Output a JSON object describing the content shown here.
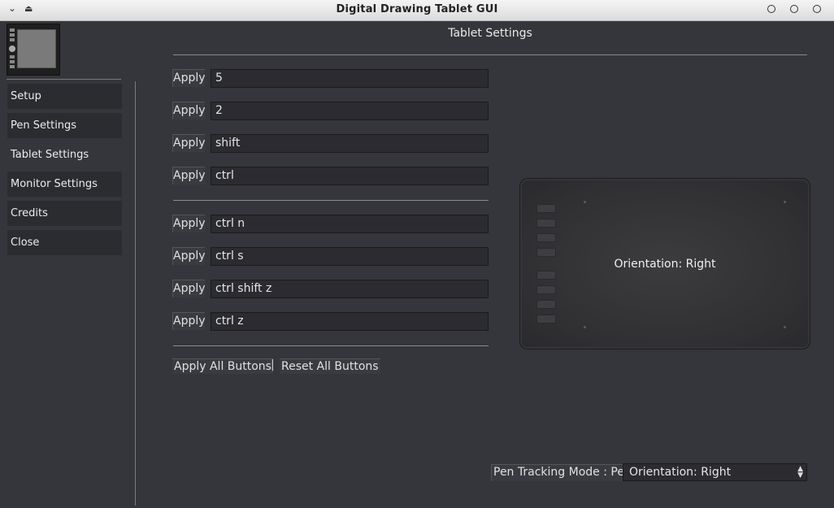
{
  "window": {
    "title": "Digital Drawing Tablet GUI"
  },
  "sidebar": {
    "items": [
      {
        "label": "Setup"
      },
      {
        "label": "Pen Settings"
      },
      {
        "label": "Tablet Settings"
      },
      {
        "label": "Monitor Settings"
      },
      {
        "label": "Credits"
      },
      {
        "label": "Close"
      }
    ],
    "active_index": 2
  },
  "main": {
    "title": "Tablet Settings",
    "apply_label": "Apply",
    "buttons_group_1": [
      "5",
      "2",
      "shift",
      "ctrl"
    ],
    "buttons_group_2": [
      "ctrl n",
      "ctrl s",
      "ctrl shift z",
      "ctrl z"
    ],
    "apply_all_label": "Apply All Buttons",
    "separator": "|",
    "reset_all_label": "Reset All Buttons"
  },
  "tablet": {
    "orientation_label": "Orientation: Right"
  },
  "footer": {
    "pen_tracking_label": "Pen Tracking Mode : Pen",
    "orientation_select_value": "Orientation: Right"
  },
  "icons": {
    "collapse": "chevron-down-icon",
    "shade": "eject-icon",
    "window_buttons": [
      "circle-icon",
      "circle-icon",
      "circle-icon"
    ],
    "select_arrows": "updown-arrow-icon"
  }
}
